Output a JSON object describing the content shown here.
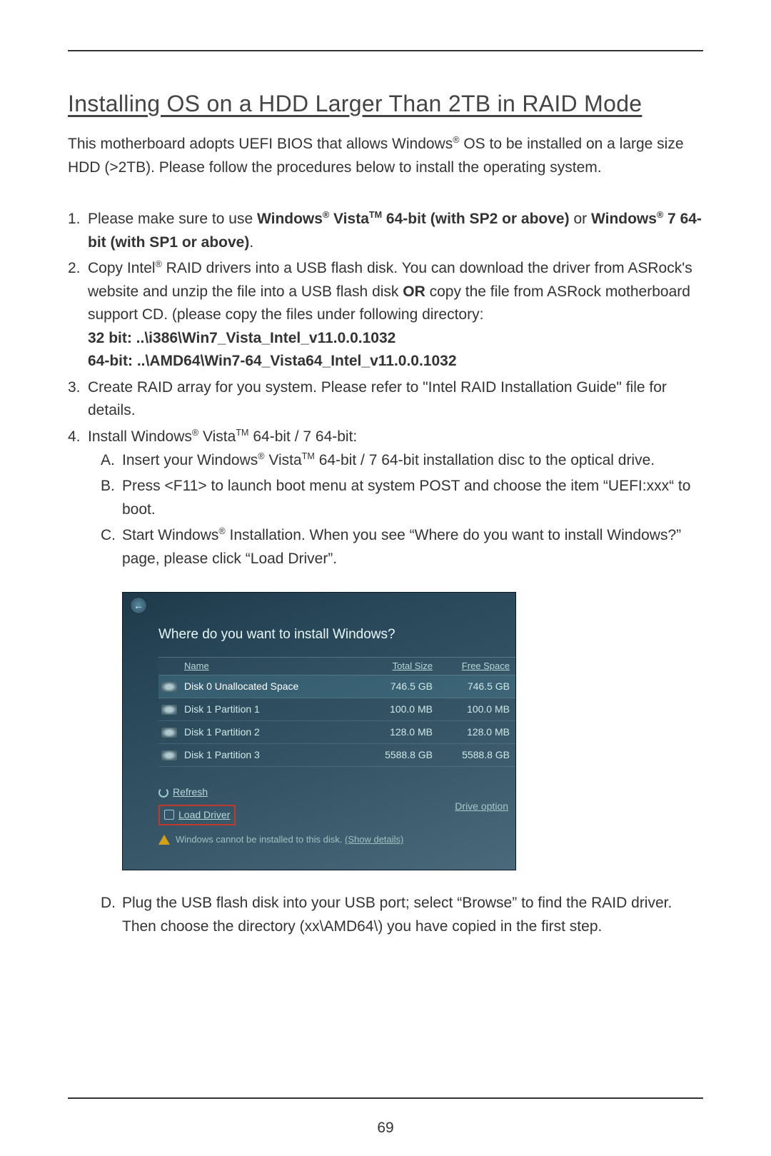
{
  "title": "Installing OS on a HDD Larger Than 2TB in RAID Mode",
  "intro": {
    "p1a": "This motherboard adopts UEFI BIOS that allows Windows",
    "p1b": " OS to be installed on a large size HDD (>2TB). Please follow the procedures below to install the operating system."
  },
  "step1": {
    "a": "Please make sure to use ",
    "b": "Windows",
    "c": " Vista",
    "d": " 64-bit (with SP2 or above) ",
    "e": "or ",
    "f": "Windows",
    "g": " 7 64-bit (with SP1 or above)",
    "h": "."
  },
  "step2": {
    "a": "Copy Intel",
    "b": " RAID drivers into a USB flash disk. You can download the driver from ASRock's website and unzip the file into a USB flash disk ",
    "c": "OR",
    "d": " copy the file from ASRock motherboard support CD. (please copy the files under following directory:",
    "e": "32 bit: ..\\i386\\Win7_Vista_Intel_v11.0.0.1032",
    "f": "64-bit: ..\\AMD64\\Win7-64_Vista64_Intel_v11.0.0.1032"
  },
  "step3": "Create RAID array for you system. Please refer to \"Intel RAID Installation Guide\" file for details.",
  "step4": {
    "a": "Install Windows",
    "b": " Vista",
    "c": " 64-bit / 7 64-bit:"
  },
  "s4A": {
    "a": "Insert your Windows",
    "b": " Vista",
    "c": " 64-bit / 7 64-bit installation disc to the optical drive."
  },
  "s4B": "Press <F11> to launch boot menu at system POST and choose the item “UEFI:xxx“ to boot.",
  "s4C": {
    "a": "Start Windows",
    "b": " Installation. When you see “Where do you want to install Windows?” page, please click “Load Driver”."
  },
  "s4D": "Plug the USB flash disk into your USB port; select “Browse” to find the RAID driver. Then choose the directory (xx\\AMD64\\) you have copied in the first step.",
  "screenshot": {
    "question": "Where do you want to install Windows?",
    "headers": {
      "name": "Name",
      "size": "Total Size",
      "free": "Free Space"
    },
    "rows": [
      {
        "name": "Disk 0 Unallocated Space",
        "size": "746.5 GB",
        "free": "746.5 GB"
      },
      {
        "name": "Disk 1 Partition 1",
        "size": "100.0 MB",
        "free": "100.0 MB"
      },
      {
        "name": "Disk 1 Partition 2",
        "size": "128.0 MB",
        "free": "128.0 MB"
      },
      {
        "name": "Disk 1 Partition 3",
        "size": "5588.8 GB",
        "free": "5588.8 GB"
      }
    ],
    "refresh": "Refresh",
    "load": "Load Driver",
    "driveopt": "Drive option",
    "warn_a": "Windows cannot be installed to this disk. ",
    "warn_b": "(Show details)"
  },
  "pagenum": "69",
  "reg": "®",
  "tm": "TM"
}
